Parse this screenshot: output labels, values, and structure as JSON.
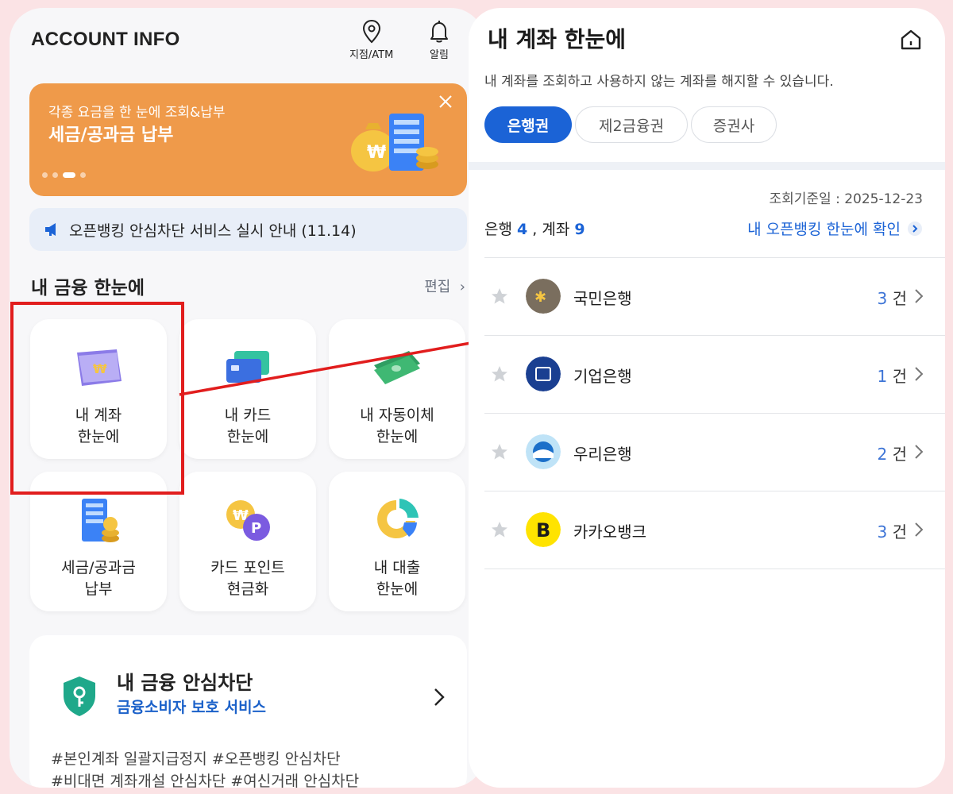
{
  "left": {
    "app_title": "ACCOUNT INFO",
    "branch": "지점/ATM",
    "alarm": "알림",
    "banner": {
      "sub": "각종 요금을 한 눈에 조회&납부",
      "title": "세금/공과금 납부"
    },
    "notice": "오픈뱅킹 안심차단 서비스 실시 안내 (11.14)",
    "section_title": "내 금융 한눈에",
    "edit": "편집",
    "tiles": [
      {
        "label": "내 계좌\n한눈에",
        "icon": "calendar-wallet-icon"
      },
      {
        "label": "내 카드\n한눈에",
        "icon": "cards-icon"
      },
      {
        "label": "내 자동이체\n한눈에",
        "icon": "cash-stack-icon"
      },
      {
        "label": "세금/공과금\n납부",
        "icon": "building-coins-icon"
      },
      {
        "label": "카드 포인트\n현금화",
        "icon": "won-point-coins-icon"
      },
      {
        "label": "내 대출\n한눈에",
        "icon": "pie-donut-icon"
      }
    ],
    "safe": {
      "title": "내 금융 안심차단",
      "sub": "금융소비자 보호 서비스",
      "tags": "#본인계좌 일괄지급정지 #오픈뱅킹 안심차단\n#비대면 계좌개설 안심차단 #여신거래 안심차단"
    }
  },
  "right": {
    "title": "내 계좌 한눈에",
    "desc": "내 계좌를 조회하고 사용하지 않는 계좌를 해지할 수 있습니다.",
    "tabs": [
      "은행권",
      "제2금융권",
      "증권사"
    ],
    "basis": "조회기준일 : 2025-12-23",
    "summary": {
      "bank_label": "은행",
      "bank_count": "4",
      "account_label": "계좌",
      "account_count": "9"
    },
    "open_link": "내 오픈뱅킹 한눈에 확인",
    "banks": [
      {
        "name": "국민은행",
        "count": "3",
        "unit": "건"
      },
      {
        "name": "기업은행",
        "count": "1",
        "unit": "건"
      },
      {
        "name": "우리은행",
        "count": "2",
        "unit": "건"
      },
      {
        "name": "카카오뱅크",
        "count": "3",
        "unit": "건"
      }
    ]
  },
  "colors": {
    "accent": "#1b63d6",
    "banner": "#ef9a4a",
    "highlight": "#e11d1d"
  }
}
